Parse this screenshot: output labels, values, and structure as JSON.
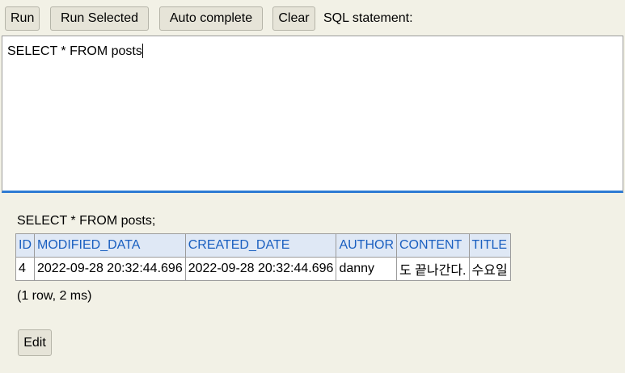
{
  "toolbar": {
    "run_label": "Run",
    "run_selected_label": "Run Selected",
    "auto_complete_label": "Auto complete",
    "clear_label": "Clear",
    "sql_statement_label": "SQL statement:"
  },
  "editor": {
    "value": "SELECT * FROM posts"
  },
  "results": {
    "query_echo": "SELECT * FROM posts;",
    "columns": [
      "ID",
      "MODIFIED_DATA",
      "CREATED_DATE",
      "AUTHOR",
      "CONTENT",
      "TITLE"
    ],
    "rows": [
      [
        "4",
        "2022-09-28 20:32:44.696",
        "2022-09-28 20:32:44.696",
        "danny",
        "도 끝나간다.",
        "수요일"
      ]
    ],
    "row_count": "(1 row, 2 ms)",
    "edit_label": "Edit"
  },
  "colors": {
    "background": "#f2f1e6",
    "header_text": "#1a5fc0",
    "header_bg": "#dfe8f5",
    "editor_focus_border": "#2e7bd3"
  }
}
